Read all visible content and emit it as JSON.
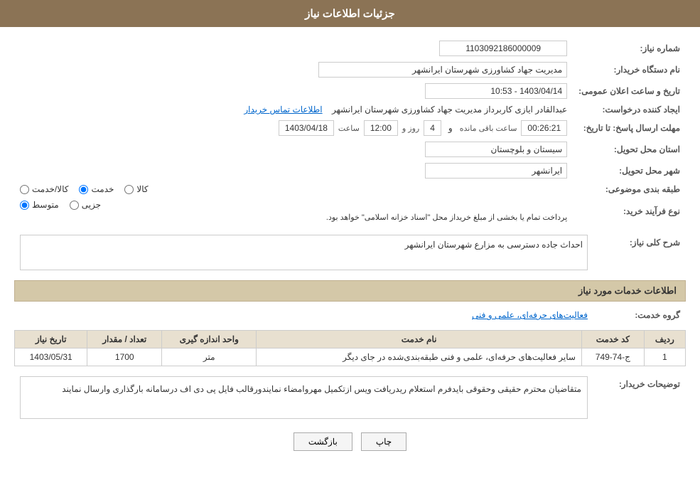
{
  "header": {
    "title": "جزئیات اطلاعات نیاز"
  },
  "fields": {
    "need_number_label": "شماره نیاز:",
    "need_number_value": "1103092186000009",
    "buyer_org_label": "نام دستگاه خریدار:",
    "buyer_org_value": "مدیریت جهاد کشاورزی شهرستان ایرانشهر",
    "announcement_date_label": "تاریخ و ساعت اعلان عمومی:",
    "announcement_date_value": "1403/04/14 - 10:53",
    "creator_label": "ایجاد کننده درخواست:",
    "creator_value": "عبدالقادر ایازی کاربرداز مدیریت جهاد کشاورزی شهرستان ایرانشهر",
    "contact_link": "اطلاعات تماس خریدار",
    "deadline_label": "مهلت ارسال پاسخ: تا تاریخ:",
    "deadline_date": "1403/04/18",
    "deadline_time_label": "ساعت",
    "deadline_time": "12:00",
    "deadline_days_label": "روز و",
    "deadline_days": "4",
    "deadline_remaining_label": "ساعت باقی مانده",
    "deadline_remaining": "00:26:21",
    "province_label": "استان محل تحویل:",
    "province_value": "سیستان و بلوچستان",
    "city_label": "شهر محل تحویل:",
    "city_value": "ایرانشهر",
    "category_label": "طبقه بندی موضوعی:",
    "category_options": [
      "کالا",
      "خدمت",
      "کالا/خدمت"
    ],
    "category_selected": "خدمت",
    "process_label": "نوع فرآیند خرید:",
    "process_options": [
      "جزیی",
      "متوسط"
    ],
    "process_selected": "متوسط",
    "process_note": "پرداخت تمام یا بخشی از مبلغ خریداز محل \"اسناد خزانه اسلامی\" خواهد بود.",
    "need_desc_label": "شرح کلی نیاز:",
    "need_desc_value": "احداث جاده دسترسی به مزارع شهرستان ایرانشهر",
    "services_section_title": "اطلاعات خدمات مورد نیاز",
    "service_group_label": "گروه خدمت:",
    "service_group_value": "فعالیت‌های حرفه‌ای، علمی و فنی",
    "table": {
      "columns": [
        "ردیف",
        "کد خدمت",
        "نام خدمت",
        "واحد اندازه گیری",
        "تعداد / مقدار",
        "تاریخ نیاز"
      ],
      "rows": [
        {
          "row": "1",
          "code": "ج-74-749",
          "name": "سایر فعالیت‌های حرفه‌ای، علمی و فنی طبقه‌بندی‌شده در جای دیگر",
          "unit": "متر",
          "quantity": "1700",
          "date": "1403/05/31"
        }
      ]
    },
    "buyer_notes_label": "توضیحات خریدار:",
    "buyer_notes_value": "متقاضیان محترم حقیقی وحقوقی بایدفرم استعلام ریدریافت ویس ازتکمیل مهروامضاء نمایندورقالب فایل پی دی اف درسامانه بارگذاری وارسال نمایند"
  },
  "buttons": {
    "print": "چاپ",
    "back": "بازگشت"
  }
}
